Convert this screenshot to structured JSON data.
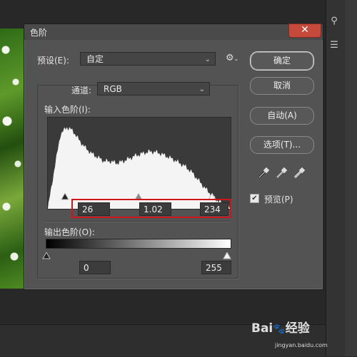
{
  "dialog": {
    "title": "色阶",
    "preset_label": "预设(E):",
    "preset_value": "自定",
    "channel_label": "通道:",
    "channel_value": "RGB",
    "input_levels_label": "输入色阶(I):",
    "input_black": "26",
    "input_gamma": "1.02",
    "input_white": "234",
    "output_levels_label": "输出色阶(O):",
    "output_black": "0",
    "output_white": "255",
    "buttons": {
      "ok": "确定",
      "cancel": "取消",
      "auto": "自动(A)",
      "options": "选项(T)..."
    },
    "preview_label": "预览(P)",
    "preview_checked": true
  },
  "histogram_profile": [
    0,
    40,
    78,
    86,
    82,
    72,
    64,
    58,
    54,
    50,
    50,
    48,
    50,
    53,
    56,
    58,
    60,
    60,
    58,
    55,
    52,
    48,
    44,
    38,
    30,
    22,
    15,
    9,
    5,
    2
  ],
  "watermark": {
    "brand": "Bai",
    "brand_suffix": "经验",
    "url": "jingyan.baidu.com"
  },
  "colors": {
    "dialog_bg": "#535353",
    "highlight": "#d0141b",
    "close_button": "#c64a3b"
  }
}
